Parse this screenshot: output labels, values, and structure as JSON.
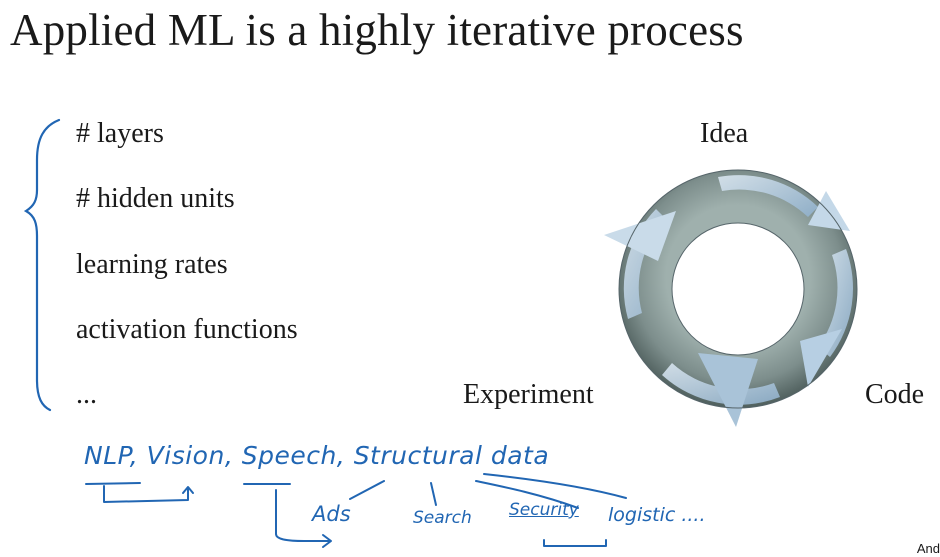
{
  "slide": {
    "title": "Applied ML is a highly iterative process",
    "hyperparameters": [
      "# layers",
      "# hidden units",
      "learning rates",
      "activation functions",
      "..."
    ],
    "cycle": {
      "idea": "Idea",
      "code": "Code",
      "experiment": "Experiment",
      "colors": {
        "ring": "#7d8e8c",
        "ring_dark": "#4f5f5d",
        "arrow": "#a9c3d8"
      }
    },
    "corner_text": "And"
  },
  "handwriting": {
    "ink_color": "#2166b3",
    "domains_line": "NLP, Vision, Speech, Structural data",
    "examples": {
      "ads": "Ads",
      "search": "Search",
      "security": "Security",
      "logistics": "logistic ...."
    }
  }
}
